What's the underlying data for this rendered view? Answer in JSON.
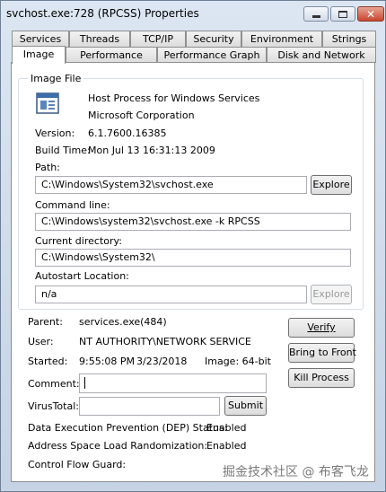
{
  "window": {
    "title": "svchost.exe:728 (RPCSS) Properties",
    "close_glyph": "✕"
  },
  "tabs": {
    "row1": [
      "Services",
      "Threads",
      "TCP/IP",
      "Security",
      "Environment",
      "Strings"
    ],
    "row2": [
      "Image",
      "Performance",
      "Performance Graph",
      "Disk and Network"
    ],
    "active": "Image"
  },
  "image_file": {
    "group_label": "Image File",
    "description": "Host Process for Windows Services",
    "company": "Microsoft Corporation",
    "version_label": "Version:",
    "version": "6.1.7600.16385",
    "build_time_label": "Build Time:",
    "build_time": "Mon Jul 13 16:31:13 2009",
    "path_label": "Path:",
    "path": "C:\\Windows\\System32\\svchost.exe",
    "explore_label": "Explore",
    "command_line_label": "Command line:",
    "command_line": "C:\\Windows\\system32\\svchost.exe -k RPCSS",
    "current_dir_label": "Current directory:",
    "current_dir": "C:\\Windows\\System32\\",
    "autostart_label": "Autostart Location:",
    "autostart": "n/a",
    "explore2_label": "Explore"
  },
  "process": {
    "parent_label": "Parent:",
    "parent": "services.exe(484)",
    "user_label": "User:",
    "user": "NT AUTHORITY\\NETWORK SERVICE",
    "started_label": "Started:",
    "started_time": "9:55:08 PM",
    "started_date": "3/23/2018",
    "image_label": "Image: 64-bit",
    "comment_label": "Comment:",
    "comment": "",
    "virustotal_label": "VirusTotal:",
    "virustotal": "",
    "submit_label": "Submit",
    "dep_label": "Data Execution Prevention (DEP) Status:",
    "dep_value": "Enabled",
    "aslr_label": "Address Space Load Randomization:",
    "aslr_value": "Enabled",
    "cfg_label": "Control Flow Guard:"
  },
  "actions": {
    "verify": "Verify",
    "bring_to_front": "Bring to Front",
    "kill_process": "Kill Process"
  },
  "watermark": "掘金技术社区 @ 布客飞龙"
}
